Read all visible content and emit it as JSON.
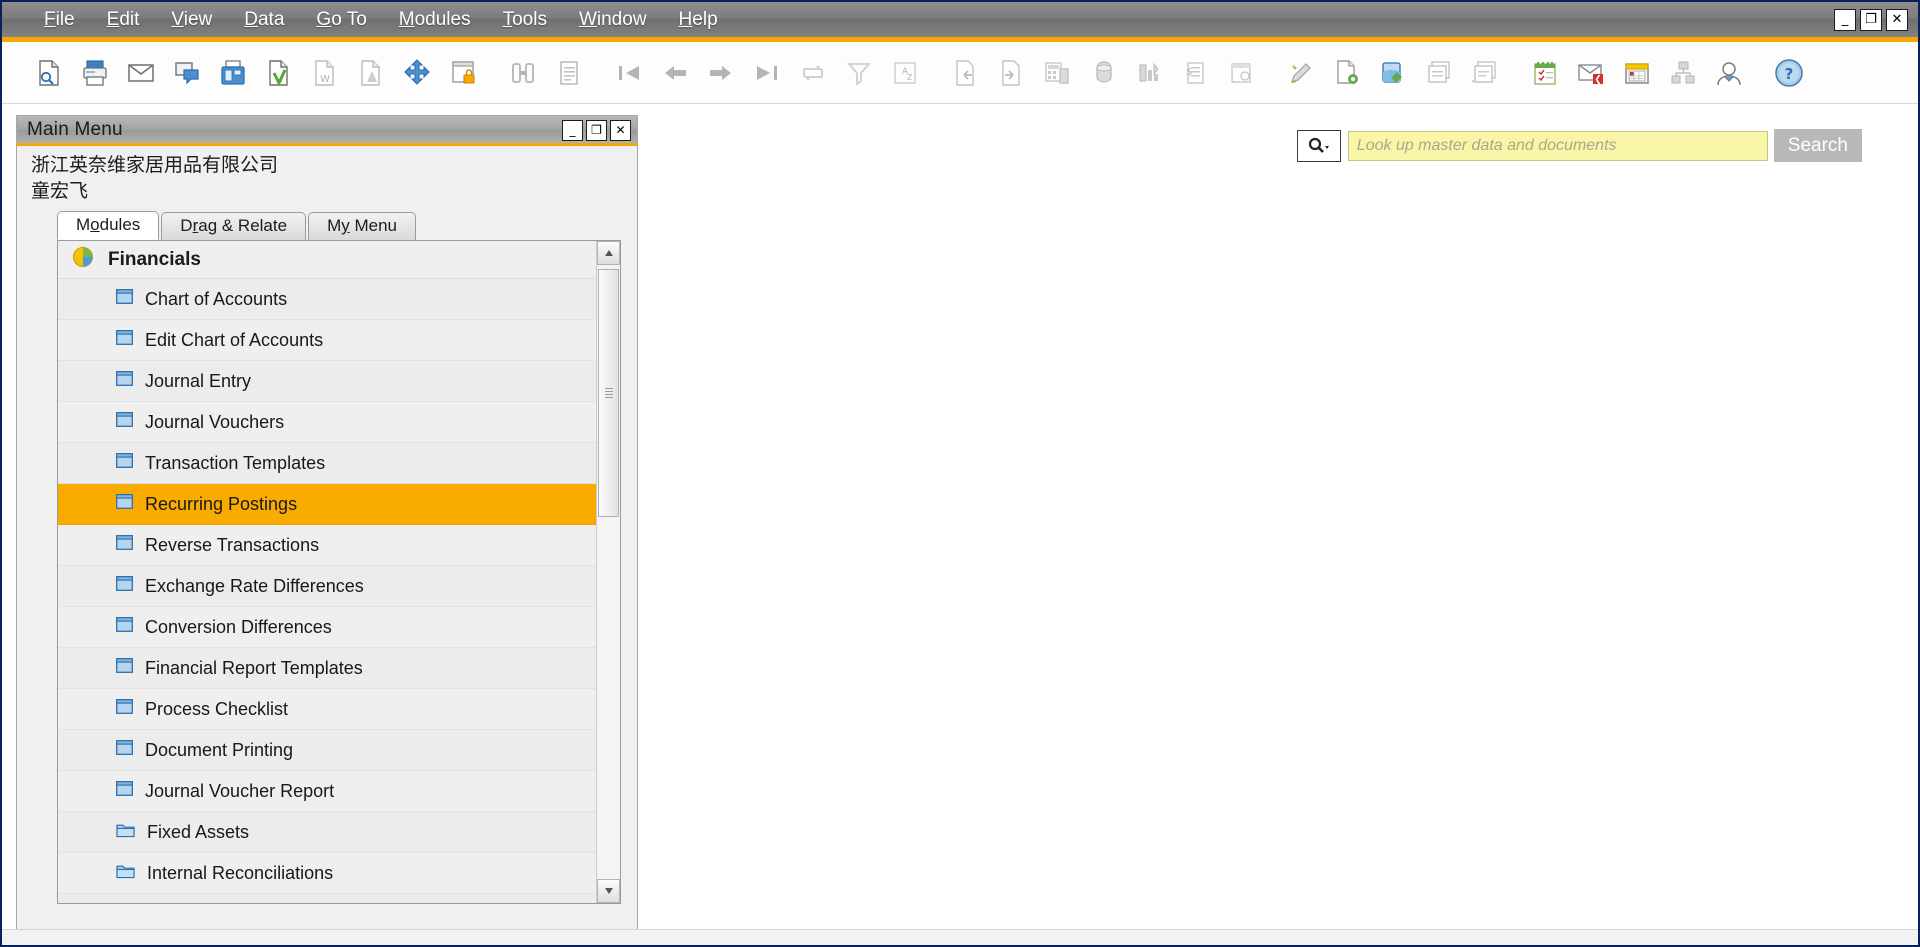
{
  "window": {
    "controls": {
      "minimize": "_",
      "restore": "❐",
      "close": "✕"
    }
  },
  "menubar": {
    "items": [
      {
        "name": "file",
        "pre": "F",
        "post": "ile"
      },
      {
        "name": "edit",
        "pre": "E",
        "post": "dit"
      },
      {
        "name": "view",
        "pre": "V",
        "post": "iew"
      },
      {
        "name": "data",
        "pre": "D",
        "post": "ata"
      },
      {
        "name": "goto",
        "pre": "G",
        "post": "o To"
      },
      {
        "name": "modules",
        "pre": "M",
        "post": "odules"
      },
      {
        "name": "tools",
        "pre": "T",
        "post": "ools"
      },
      {
        "name": "window",
        "pre": "W",
        "post": "indow"
      },
      {
        "name": "help",
        "pre": "H",
        "post": "elp"
      }
    ]
  },
  "toolbar": {
    "icons": [
      "preview-document-icon",
      "print-icon",
      "email-icon",
      "sms-icon",
      "fax-icon",
      "export-to-excel-icon",
      "export-to-word-icon",
      "export-to-pdf-icon",
      "launch-application-icon",
      "lock-screen-icon",
      "find-icon",
      "add-record-icon",
      "first-data-record-icon",
      "previous-data-record-icon",
      "next-data-record-icon",
      "last-data-record-icon",
      "refresh-icon",
      "filter-icon",
      "sort-icon",
      "previous-record-icon",
      "next-record-icon",
      "calculator-icon",
      "messages-icon",
      "gross-profit-icon",
      "item-availability-icon",
      "last-prices-icon",
      "user-defined-values-icon",
      "user-defined-fields-icon",
      "query-manager-icon",
      "query-print-layout-icon",
      "notes-icon",
      "notes-edit-icon",
      "activity-icon",
      "alerts-icon",
      "calendar-icon",
      "org-structure-icon",
      "user-profile-icon",
      "help-icon"
    ]
  },
  "search": {
    "placeholder": "Look up master data and documents",
    "value": "",
    "button_label": "Search",
    "dropdown_icon": "magnifier-dropdown-icon"
  },
  "main_menu": {
    "title": "Main Menu",
    "company": "浙江英奈维家居用品有限公司",
    "user": "童宏飞",
    "tabs": [
      {
        "name": "modules",
        "pre": "M",
        "mid": "o",
        "post": "dules",
        "active": true
      },
      {
        "name": "drag-and-relate",
        "pre": "D",
        "mid": "r",
        "post": "ag & Relate",
        "active": false
      },
      {
        "name": "my-menu",
        "pre": "M",
        "mid": "y",
        "post": " Menu",
        "active": false
      }
    ],
    "group": {
      "label": "Financials",
      "icon": "pie-chart-icon"
    },
    "items": [
      {
        "label": "Chart of Accounts",
        "icon": "window-icon",
        "selected": false
      },
      {
        "label": "Edit Chart of Accounts",
        "icon": "window-icon",
        "selected": false
      },
      {
        "label": "Journal Entry",
        "icon": "window-icon",
        "selected": false
      },
      {
        "label": "Journal Vouchers",
        "icon": "window-icon",
        "selected": false
      },
      {
        "label": "Transaction Templates",
        "icon": "window-icon",
        "selected": false
      },
      {
        "label": "Recurring Postings",
        "icon": "window-icon",
        "selected": true
      },
      {
        "label": "Reverse Transactions",
        "icon": "window-icon",
        "selected": false
      },
      {
        "label": "Exchange Rate Differences",
        "icon": "window-icon",
        "selected": false
      },
      {
        "label": "Conversion Differences",
        "icon": "window-icon",
        "selected": false
      },
      {
        "label": "Financial Report Templates",
        "icon": "window-icon",
        "selected": false
      },
      {
        "label": "Process Checklist",
        "icon": "window-icon",
        "selected": false
      },
      {
        "label": "Document Printing",
        "icon": "window-icon",
        "selected": false
      },
      {
        "label": "Journal Voucher Report",
        "icon": "window-icon",
        "selected": false
      },
      {
        "label": "Fixed Assets",
        "icon": "folder-icon",
        "selected": false
      },
      {
        "label": "Internal Reconciliations",
        "icon": "folder-icon",
        "selected": false
      }
    ],
    "controls": {
      "minimize": "_",
      "restore": "❐",
      "close": "✕"
    },
    "scrollbar": {
      "up": "▲",
      "down": "▼"
    }
  },
  "colors": {
    "accent": "#f5a800",
    "selection": "#f9ab00",
    "menubar": "#7d7d7d",
    "search_field": "#faf6a8"
  }
}
